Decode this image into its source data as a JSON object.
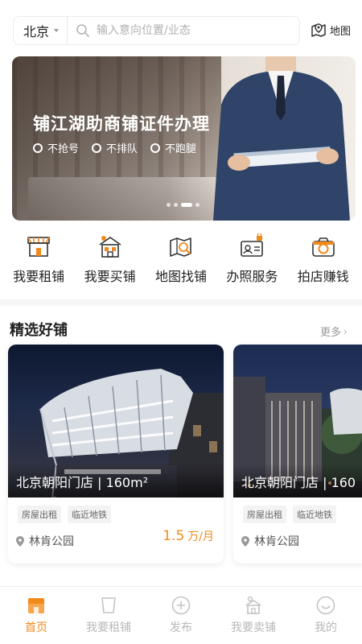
{
  "search": {
    "city": "北京",
    "placeholder": "输入意向位置/业态",
    "map_label": "地图"
  },
  "banner": {
    "title": "铺江湖助商铺证件办理",
    "tags": [
      "不抢号",
      "不排队",
      "不跑腿"
    ],
    "page_count": 4,
    "active_page": 2
  },
  "nav": {
    "items": [
      {
        "label": "我要租铺",
        "icon": "storefront-icon"
      },
      {
        "label": "我要买铺",
        "icon": "shop-building-icon"
      },
      {
        "label": "地图找铺",
        "icon": "map-search-icon"
      },
      {
        "label": "办照服务",
        "icon": "license-card-icon"
      },
      {
        "label": "拍店赚钱",
        "icon": "camera-icon"
      }
    ]
  },
  "section": {
    "title": "精选好铺",
    "more": "更多"
  },
  "cards": [
    {
      "caption": "北京朝阳门店 | 160m²",
      "tags": [
        "房屋出租",
        "临近地铁"
      ],
      "location": "林肯公园",
      "price_value": "1.5",
      "price_unit": "万/月"
    },
    {
      "caption": "北京朝阳门店 | 160",
      "tags": [
        "房屋出租",
        "临近地铁"
      ],
      "location": "林肯公园"
    }
  ],
  "tabbar": {
    "items": [
      {
        "label": "首页",
        "icon": "home-icon",
        "active": true
      },
      {
        "label": "我要租铺",
        "icon": "bag-icon",
        "active": false
      },
      {
        "label": "发布",
        "icon": "plus-circle-icon",
        "active": false
      },
      {
        "label": "我要卖铺",
        "icon": "shop-sell-icon",
        "active": false
      },
      {
        "label": "我的",
        "icon": "profile-smile-icon",
        "active": false
      }
    ]
  },
  "colors": {
    "accent": "#f08a1b",
    "text": "#222222",
    "muted": "#b8b8b8"
  }
}
